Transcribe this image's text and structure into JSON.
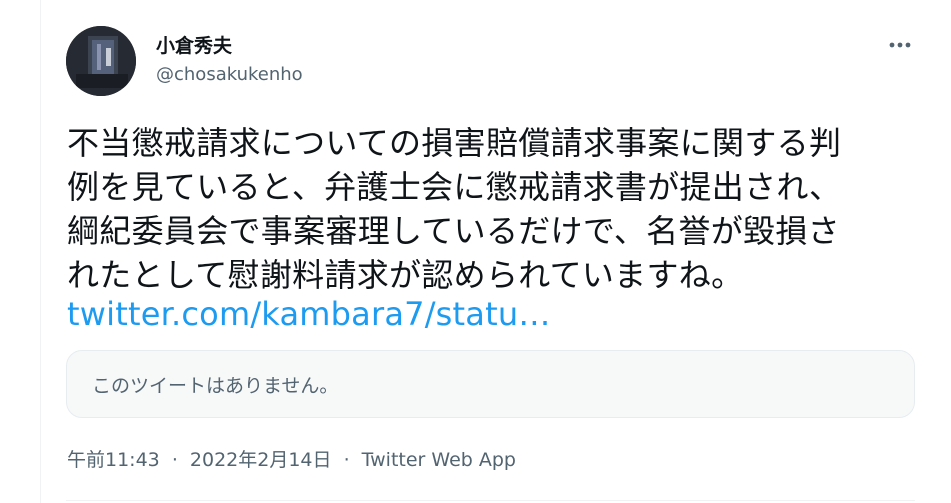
{
  "author": {
    "display_name": "小倉秀夫",
    "handle": "@chosakukenho",
    "avatar_icon": "user-avatar"
  },
  "menu": {
    "more_icon": "more-horizontal-icon"
  },
  "tweet": {
    "text": "不当懲戒請求についての損害賠償請求事案に関する判\n例を見ていると、弁護士会に懲戒請求書が提出され、\n綱紀委員会で事案審理しているだけで、名誉が毀損さ\nれたとして慰謝料請求が認められていますね。",
    "link_text": "twitter.com/kambara7/statu…"
  },
  "quote": {
    "unavailable_text": "このツイートはありません。"
  },
  "meta": {
    "time": "午前11:43",
    "separator": "·",
    "date": "2022年2月14日",
    "source": "Twitter Web App"
  },
  "colors": {
    "link": "#1d9bf0",
    "secondary_text": "#536471",
    "primary_text": "#0f1419",
    "card_background": "#f7f9f9"
  }
}
